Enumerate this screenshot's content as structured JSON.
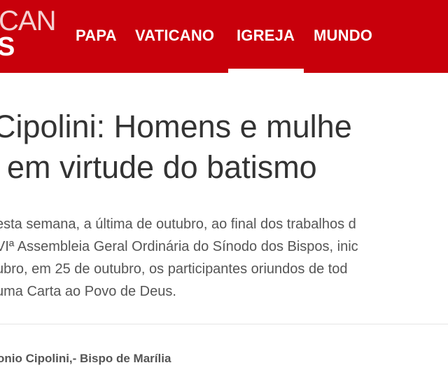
{
  "header": {
    "logo_top": "CAN",
    "logo_bottom": "S",
    "nav": [
      {
        "label": "PAPA"
      },
      {
        "label": "VATICANO"
      },
      {
        "label": "IGREJA"
      },
      {
        "label": "MUNDO"
      }
    ],
    "active_tab": "IGREJA"
  },
  "article": {
    "headline_line1": "Cipolini: Homens e mulhe",
    "headline_line2": "em virtude do batismo",
    "lead_lines": [
      "esta semana, a última de outubro, ao final dos trabalhos d",
      "VIª Assembleia Geral Ordinária do Sínodo dos Bispos, inic",
      "ubro, em 25 de outubro, os participantes oriundos de tod",
      "uma Carta ao Povo de Deus."
    ],
    "author": "onio Cipolini,- Bispo de Marília"
  },
  "colors": {
    "header_bg": "#c8000b",
    "headline": "#333333",
    "body_text": "#555555"
  }
}
